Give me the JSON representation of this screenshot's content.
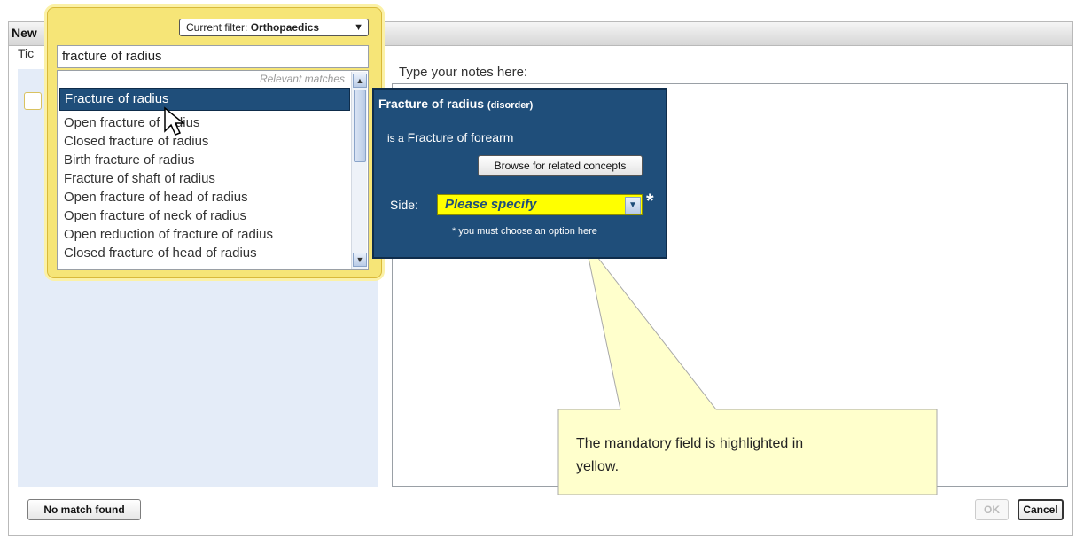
{
  "window": {
    "title": "New"
  },
  "left_panel": {
    "tick_label": "Tic"
  },
  "notes": {
    "label": "Type your notes here:"
  },
  "search": {
    "filter_prefix": "Current filter:",
    "filter_value": "Orthopaedics",
    "query": "fracture of radius",
    "relevant_label": "Relevant matches",
    "results": [
      "Fracture of radius",
      "Open fracture of radius",
      "Closed fracture of radius",
      "Birth fracture of radius",
      "Fracture of shaft of radius",
      "Open fracture of head of radius",
      "Open fracture of neck of radius",
      "Open reduction of fracture of radius",
      "Closed fracture of head of radius"
    ]
  },
  "concept": {
    "name": "Fracture of radius",
    "type": "(disorder)",
    "isa_prefix": "is a",
    "isa_value": "Fracture of forearm",
    "browse_label": "Browse for related concepts",
    "side_label": "Side:",
    "side_value": "Please specify",
    "required_marker": "*",
    "must_note": "* you must choose an option here"
  },
  "callout": {
    "line1": "The mandatory field is highlighted in",
    "line2": "yellow."
  },
  "buttons": {
    "no_match": "No match found",
    "ok": "OK",
    "cancel": "Cancel"
  },
  "colors": {
    "concept_bg": "#1f4e7a",
    "popup_bg": "#f6e577",
    "highlight": "#ffff00",
    "callout_bg": "#ffffcc"
  }
}
